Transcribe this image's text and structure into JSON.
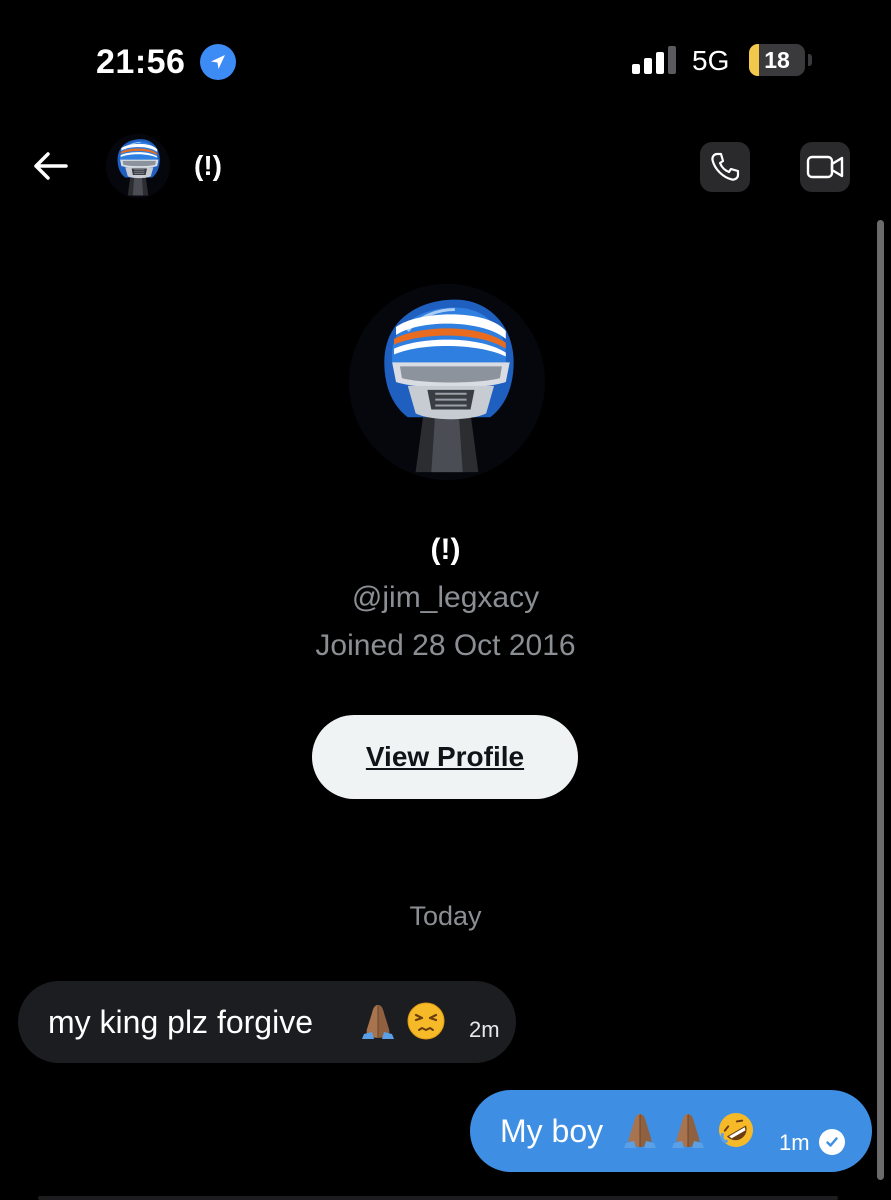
{
  "status_bar": {
    "time": "21:56",
    "network": "5G",
    "battery_level": "18",
    "battery_fraction": 0.18,
    "signal_bars_filled": 3,
    "signal_bars_total": 4
  },
  "header": {
    "contact_name": "(!)"
  },
  "profile": {
    "display_name": "(!)",
    "handle": "@jim_legxacy",
    "joined": "Joined 28 Oct 2016",
    "view_profile_label": "View Profile"
  },
  "conversation": {
    "day_label": "Today",
    "messages": [
      {
        "direction": "received",
        "text": "my king plz forgive",
        "emojis": [
          "folded-hands-medium-dark",
          "persevering-face"
        ],
        "time": "2m"
      },
      {
        "direction": "sent",
        "text": "My boy",
        "emojis": [
          "folded-hands-medium-dark",
          "folded-hands-medium-dark",
          "rolling-on-floor-laughing"
        ],
        "time": "1m",
        "status": "read"
      }
    ]
  },
  "colors": {
    "background": "#000000",
    "secondary_text": "#8b8f94",
    "received_bubble": "#1c1d20",
    "sent_bubble": "#3e8fe3",
    "button_bg": "#eff3f4",
    "location_blue": "#3d8bf5",
    "battery_yellow": "#f2c94c"
  }
}
